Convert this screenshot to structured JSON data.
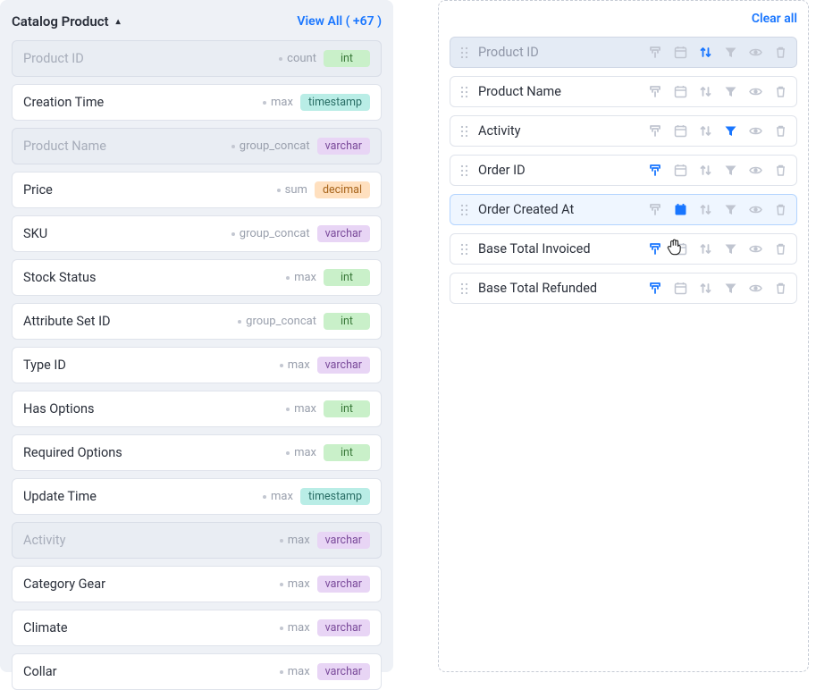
{
  "leftPanel": {
    "title": "Catalog Product",
    "viewAll": "View All ( +67 )",
    "fields": [
      {
        "name": "Product ID",
        "agg": "count",
        "type": "int",
        "dimmed": true
      },
      {
        "name": "Creation Time",
        "agg": "max",
        "type": "timestamp",
        "dimmed": false
      },
      {
        "name": "Product Name",
        "agg": "group_concat",
        "type": "varchar",
        "dimmed": true
      },
      {
        "name": "Price",
        "agg": "sum",
        "type": "decimal",
        "dimmed": false
      },
      {
        "name": "SKU",
        "agg": "group_concat",
        "type": "varchar",
        "dimmed": false
      },
      {
        "name": "Stock Status",
        "agg": "max",
        "type": "int",
        "dimmed": false
      },
      {
        "name": "Attribute Set ID",
        "agg": "group_concat",
        "type": "int",
        "dimmed": false
      },
      {
        "name": "Type ID",
        "agg": "max",
        "type": "varchar",
        "dimmed": false
      },
      {
        "name": "Has Options",
        "agg": "max",
        "type": "int",
        "dimmed": false
      },
      {
        "name": "Required Options",
        "agg": "max",
        "type": "int",
        "dimmed": false
      },
      {
        "name": "Update Time",
        "agg": "max",
        "type": "timestamp",
        "dimmed": false
      },
      {
        "name": "Activity",
        "agg": "max",
        "type": "varchar",
        "dimmed": true
      },
      {
        "name": "Category Gear",
        "agg": "max",
        "type": "varchar",
        "dimmed": false
      },
      {
        "name": "Climate",
        "agg": "max",
        "type": "varchar",
        "dimmed": false
      },
      {
        "name": "Collar",
        "agg": "max",
        "type": "varchar",
        "dimmed": false
      }
    ]
  },
  "rightPanel": {
    "clearAll": "Clear all",
    "selected": [
      {
        "name": "Product ID",
        "style": "header",
        "icons": {
          "agg": false,
          "cal": false,
          "sort": true,
          "filter": false,
          "eye": false,
          "trash": false
        }
      },
      {
        "name": "Product Name",
        "style": "normal",
        "icons": {
          "agg": false,
          "cal": false,
          "sort": false,
          "filter": false,
          "eye": false,
          "trash": false
        }
      },
      {
        "name": "Activity",
        "style": "normal",
        "icons": {
          "agg": false,
          "cal": false,
          "sort": false,
          "filter": true,
          "eye": false,
          "trash": false
        }
      },
      {
        "name": "Order ID",
        "style": "normal",
        "icons": {
          "agg": true,
          "cal": false,
          "sort": false,
          "filter": false,
          "eye": false,
          "trash": false
        }
      },
      {
        "name": "Order Created At",
        "style": "highlight",
        "icons": {
          "agg": false,
          "cal": true,
          "sort": false,
          "filter": false,
          "eye": false,
          "trash": false
        }
      },
      {
        "name": "Base Total Invoiced",
        "style": "normal",
        "icons": {
          "agg": true,
          "cal": false,
          "sort": false,
          "filter": false,
          "eye": false,
          "trash": false
        }
      },
      {
        "name": "Base Total Refunded",
        "style": "normal",
        "icons": {
          "agg": true,
          "cal": false,
          "sort": false,
          "filter": false,
          "eye": false,
          "trash": false
        }
      }
    ]
  }
}
